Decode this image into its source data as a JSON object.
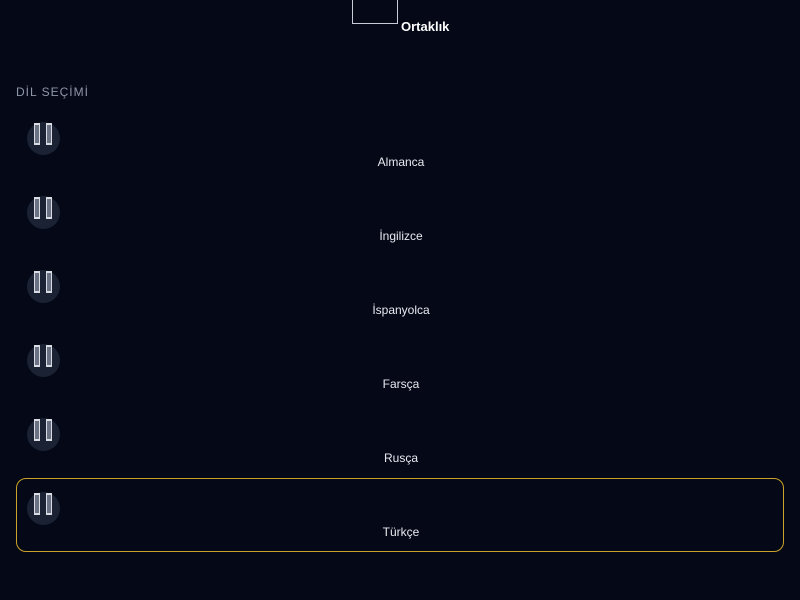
{
  "header": {
    "label": "Ortaklık"
  },
  "language_section": {
    "title": "DİL SEÇİMİ",
    "selected": "Türkçe",
    "accent_color": "#c9a227",
    "items": [
      {
        "label": "Almanca",
        "icon": "broken-flag-icon"
      },
      {
        "label": "İngilizce",
        "icon": "broken-flag-icon"
      },
      {
        "label": "İspanyolca",
        "icon": "broken-flag-icon"
      },
      {
        "label": "Farsça",
        "icon": "broken-flag-icon"
      },
      {
        "label": "Rusça",
        "icon": "broken-flag-icon"
      },
      {
        "label": "Türkçe",
        "icon": "broken-flag-icon"
      }
    ]
  }
}
